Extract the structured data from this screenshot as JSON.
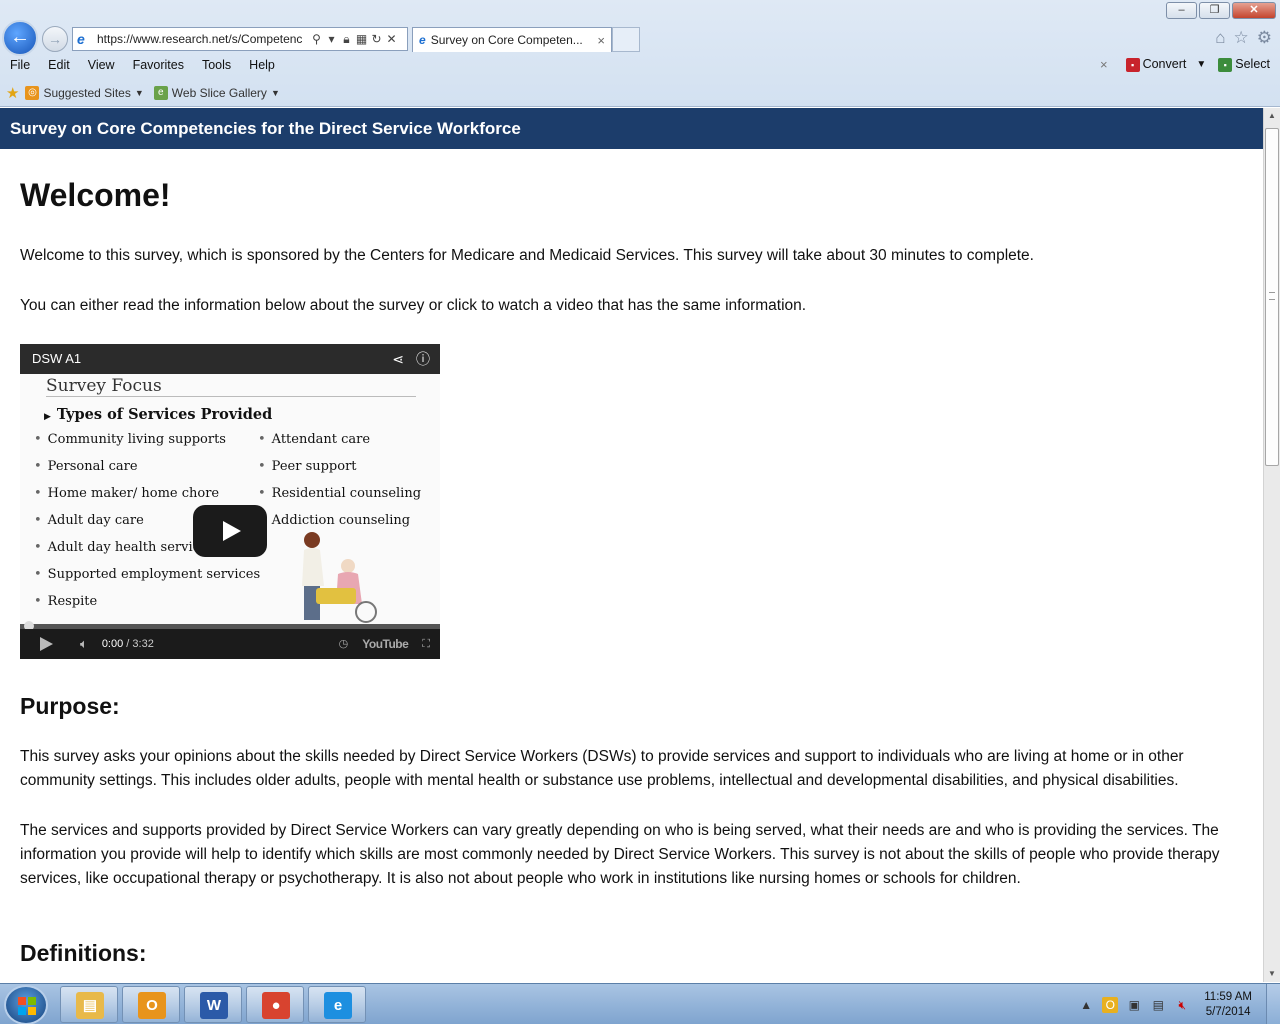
{
  "browser": {
    "url": "https://www.research.net/s/Competenc",
    "tab_title": "Survey on Core Competen...",
    "tab_close": "×",
    "menu": [
      "File",
      "Edit",
      "View",
      "Favorites",
      "Tools",
      "Help"
    ],
    "commands": {
      "close": "×",
      "convert": "Convert",
      "select": "Select"
    },
    "favorites": [
      {
        "label": "Suggested Sites",
        "icon": "suggested-sites-icon"
      },
      {
        "label": "Web Slice Gallery",
        "icon": "web-slice-icon"
      }
    ],
    "window_controls": {
      "minimize": "–",
      "restore": "❐",
      "close": "✕"
    }
  },
  "survey": {
    "header": "Survey on Core Competencies for the Direct Service Workforce",
    "welcome_title": "Welcome!",
    "welcome_p1": "Welcome to this survey, which is sponsored by the Centers for Medicare and Medicaid Services. This survey will take about 30 minutes to complete.",
    "welcome_p2": "You can either read the information below about the survey or click to watch a video that has the same information.",
    "purpose_title": "Purpose:",
    "purpose_p1": "This survey asks your opinions about the skills needed by Direct Service Workers (DSWs) to provide services and support to individuals who are living at home or in other community settings. This includes older adults, people with mental health or substance use problems, intellectual and developmental disabilities, and physical disabilities.",
    "purpose_p2": "The services and supports provided by Direct Service Workers can vary greatly depending on who is being served, what their needs are and who is providing the services. The information you provide will help to identify which skills are most commonly needed by Direct Service Workers. This survey is not about the skills of people who provide therapy services, like occupational therapy or psychotherapy. It is also not about people who work in institutions like nursing homes or schools for children.",
    "definitions_title": "Definitions:"
  },
  "video": {
    "title": "DSW A1",
    "slide_title": "Survey Focus",
    "slide_subtitle": "Types of Services Provided",
    "left_items": [
      "Community living supports",
      "Personal care",
      "Home maker/ home chore",
      "Adult day care",
      "Adult day health services",
      "Supported employment services",
      "Respite"
    ],
    "right_items": [
      "Attendant care",
      "Peer support",
      "Residential counseling",
      "Addiction counseling"
    ],
    "time_current": "0:00",
    "time_total": "/ 3:32",
    "progress": 0,
    "brand": "YouTube"
  },
  "taskbar": {
    "apps": [
      {
        "name": "file-explorer",
        "glyph": "▤",
        "color": "#e8b94a"
      },
      {
        "name": "outlook",
        "glyph": "O",
        "color": "#e8941c"
      },
      {
        "name": "word",
        "glyph": "W",
        "color": "#2b5aa8"
      },
      {
        "name": "chrome",
        "glyph": "●",
        "color": "#d8432f"
      },
      {
        "name": "internet-explorer",
        "glyph": "e",
        "color": "#1d8fe0"
      }
    ],
    "clock_time": "11:59 AM",
    "clock_date": "5/7/2014"
  }
}
